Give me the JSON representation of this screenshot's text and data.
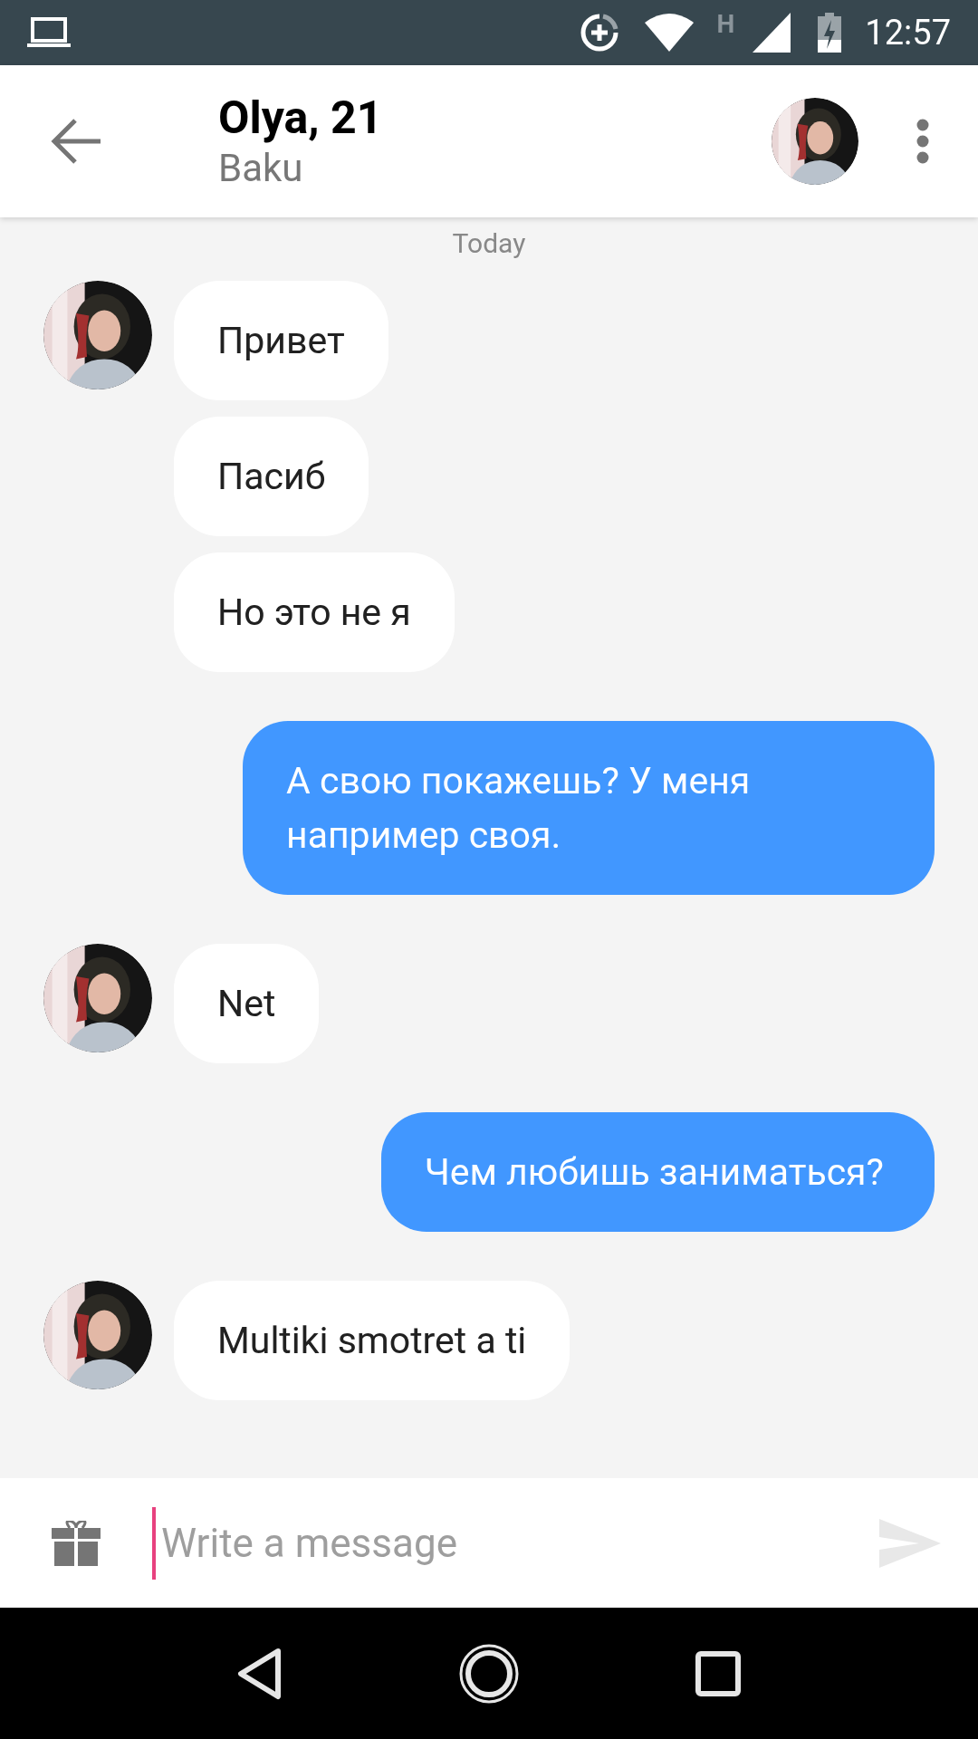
{
  "status_bar": {
    "time": "12:57",
    "network_label": "H"
  },
  "header": {
    "title": "Olya, 21",
    "subtitle": "Baku"
  },
  "date_divider": "Today",
  "groups": [
    {
      "kind": "incoming",
      "messages": [
        "Привет",
        "Пасиб",
        "Но это не я"
      ]
    },
    {
      "kind": "outgoing",
      "messages": [
        "А свою покажешь? У меня например своя."
      ]
    },
    {
      "kind": "incoming",
      "messages": [
        "Net"
      ]
    },
    {
      "kind": "outgoing",
      "messages": [
        "Чем любишь заниматься?"
      ]
    },
    {
      "kind": "incoming",
      "messages": [
        "Multiki smotret a ti"
      ]
    }
  ],
  "composer": {
    "placeholder": "Write a message",
    "focused": true
  }
}
